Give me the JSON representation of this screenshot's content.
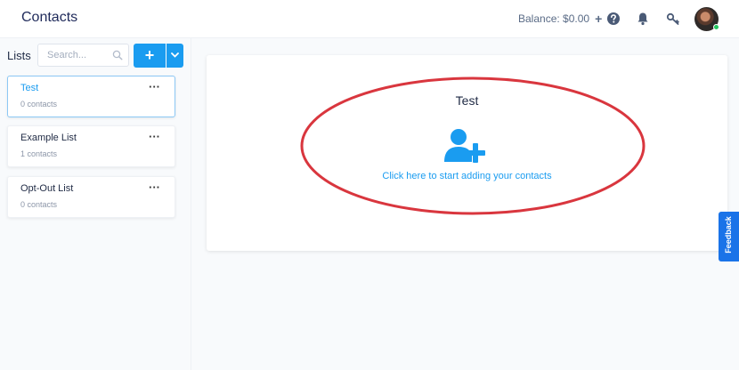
{
  "header": {
    "title": "Contacts",
    "balance_label": "Balance: $0.00",
    "balance_add": "+",
    "icons": [
      "help-icon",
      "bell-icon",
      "key-icon"
    ],
    "online_status_color": "#22c55e"
  },
  "sidebar": {
    "lists_label": "Lists",
    "search_placeholder": "Search...",
    "add_button": "+",
    "items": [
      {
        "name": "Test",
        "count": "0 contacts",
        "menu": "···",
        "active": true
      },
      {
        "name": "Example List",
        "count": "1 contacts",
        "menu": "···",
        "active": false
      },
      {
        "name": "Opt-Out List",
        "count": "0 contacts",
        "menu": "···",
        "active": false
      }
    ]
  },
  "main": {
    "list_title": "Test",
    "add_contacts_link": "Click here to start adding your contacts",
    "icon": "add-user-icon",
    "annotation_color": "#d9363e"
  },
  "feedback_tab": {
    "label": "Feedback"
  },
  "colors": {
    "accent": "#1a9cf0",
    "feedback": "#1a73e8"
  }
}
